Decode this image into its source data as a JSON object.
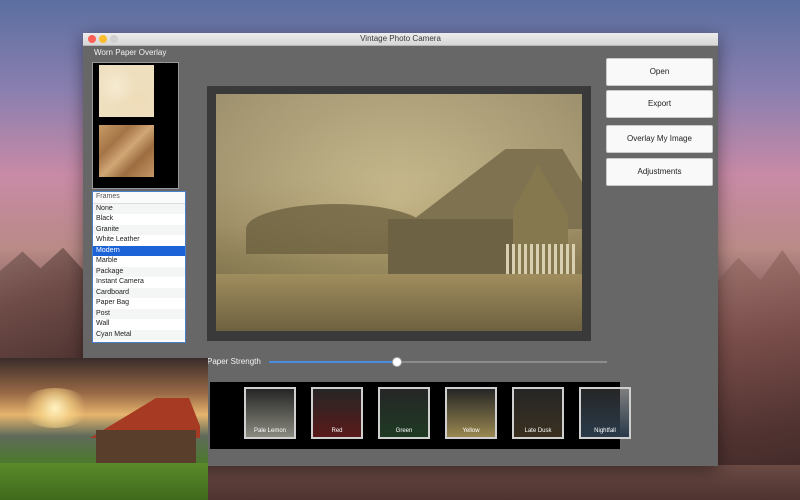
{
  "window": {
    "title": "Vintage Photo Camera"
  },
  "overlay": {
    "title": "Worn Paper Overlay"
  },
  "frames": {
    "header": "Frames",
    "items": [
      "None",
      "Black",
      "Granite",
      "White Leather",
      "Modern",
      "Marble",
      "Package",
      "Instant Camera",
      "Cardboard",
      "Paper Bag",
      "Post",
      "Wall",
      "Cyan Metal"
    ],
    "selected": "Modern"
  },
  "buttons": {
    "open": "Open",
    "export": "Export",
    "overlay": "Overlay My Image",
    "adjustments": "Adjustments"
  },
  "slider": {
    "label": "Paper Strength",
    "value_fraction": 0.38
  },
  "filters": [
    {
      "label": "Pale Lemon",
      "color": "#8a8a80"
    },
    {
      "label": "Red",
      "color": "#5a1a1a"
    },
    {
      "label": "Green",
      "color": "#1f3a24"
    },
    {
      "label": "Yellow",
      "color": "#9a8850"
    },
    {
      "label": "Late Dusk",
      "color": "#3a3020"
    },
    {
      "label": "Nightfall",
      "color": "#2a3a4a"
    }
  ]
}
